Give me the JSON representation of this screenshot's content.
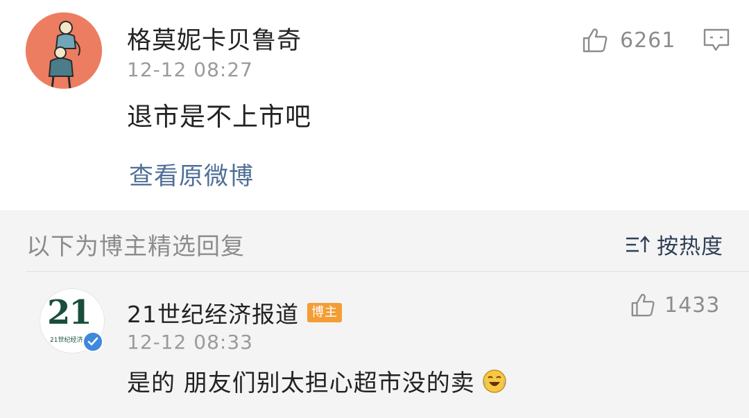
{
  "comment": {
    "username": "格莫妮卡贝鲁奇",
    "timestamp": "12-12 08:27",
    "text": "退市是不上市吧",
    "likes": "6261",
    "view_original": "查看原微博",
    "avatar_icon": "avatar-illustration-icon",
    "avatar_color": "#ec7d60"
  },
  "replies_section": {
    "title": "以下为博主精选回复",
    "sort_label": "按热度",
    "sort_icon": "sort-icon"
  },
  "reply": {
    "username": "21世纪经济报道",
    "host_badge": "博主",
    "avatar_big_text": "21",
    "avatar_small_text": "21世纪经济报道",
    "timestamp": "12-12 08:33",
    "text": "是的 朋友们别太担心超市没的卖",
    "emoji": "laughing-crying-emoji-icon",
    "likes": "1433",
    "verified": "verified-badge-icon"
  },
  "colors": {
    "link": "#4f6f98",
    "badge": "#f39d35",
    "verified": "#3e88dd",
    "section_bg": "#f4f4f4"
  }
}
